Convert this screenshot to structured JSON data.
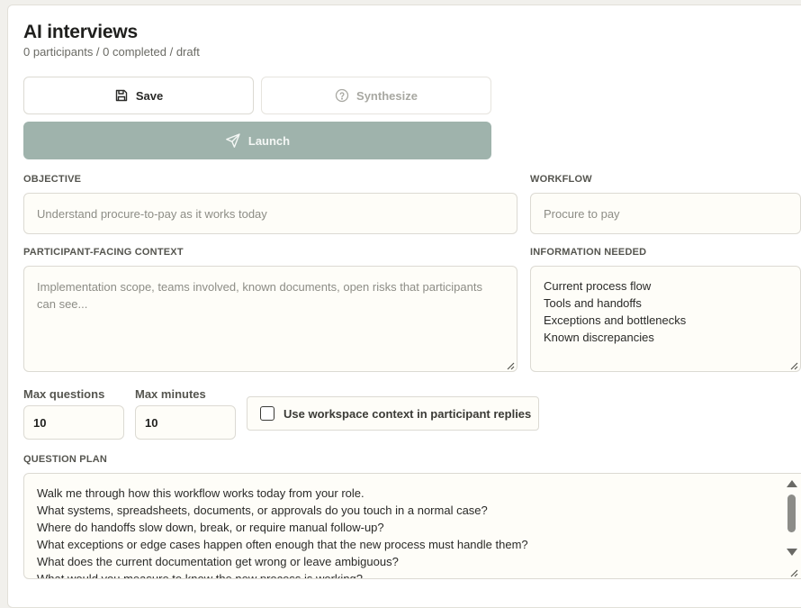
{
  "header": {
    "title": "AI interviews",
    "subtitle": "0 participants / 0 completed / draft"
  },
  "actions": {
    "save_label": "Save",
    "synthesize_label": "Synthesize",
    "launch_label": "Launch"
  },
  "objective": {
    "label": "OBJECTIVE",
    "placeholder": "Understand procure-to-pay as it works today",
    "value": ""
  },
  "workflow": {
    "label": "WORKFLOW",
    "placeholder": "Procure to pay",
    "value": ""
  },
  "participant_context": {
    "label": "PARTICIPANT-FACING CONTEXT",
    "placeholder": "Implementation scope, teams involved, known documents, open risks that participants can see...",
    "value": ""
  },
  "information_needed": {
    "label": "INFORMATION NEEDED",
    "value": "Current process flow\nTools and handoffs\nExceptions and bottlenecks\nKnown discrepancies"
  },
  "limits": {
    "max_questions_label": "Max questions",
    "max_questions_value": "10",
    "max_minutes_label": "Max minutes",
    "max_minutes_value": "10"
  },
  "workspace_context": {
    "label": "Use workspace context in participant replies",
    "checked": false
  },
  "question_plan": {
    "label": "QUESTION PLAN",
    "value": "Walk me through how this workflow works today from your role.\nWhat systems, spreadsheets, documents, or approvals do you touch in a normal case?\nWhere do handoffs slow down, break, or require manual follow-up?\nWhat exceptions or edge cases happen often enough that the new process must handle them?\nWhat does the current documentation get wrong or leave ambiguous?\nWhat would you measure to know the new process is working?"
  },
  "colors": {
    "launch_bg": "#9fb3ac",
    "field_bg": "#fefdf8",
    "border": "#dcdad3"
  }
}
